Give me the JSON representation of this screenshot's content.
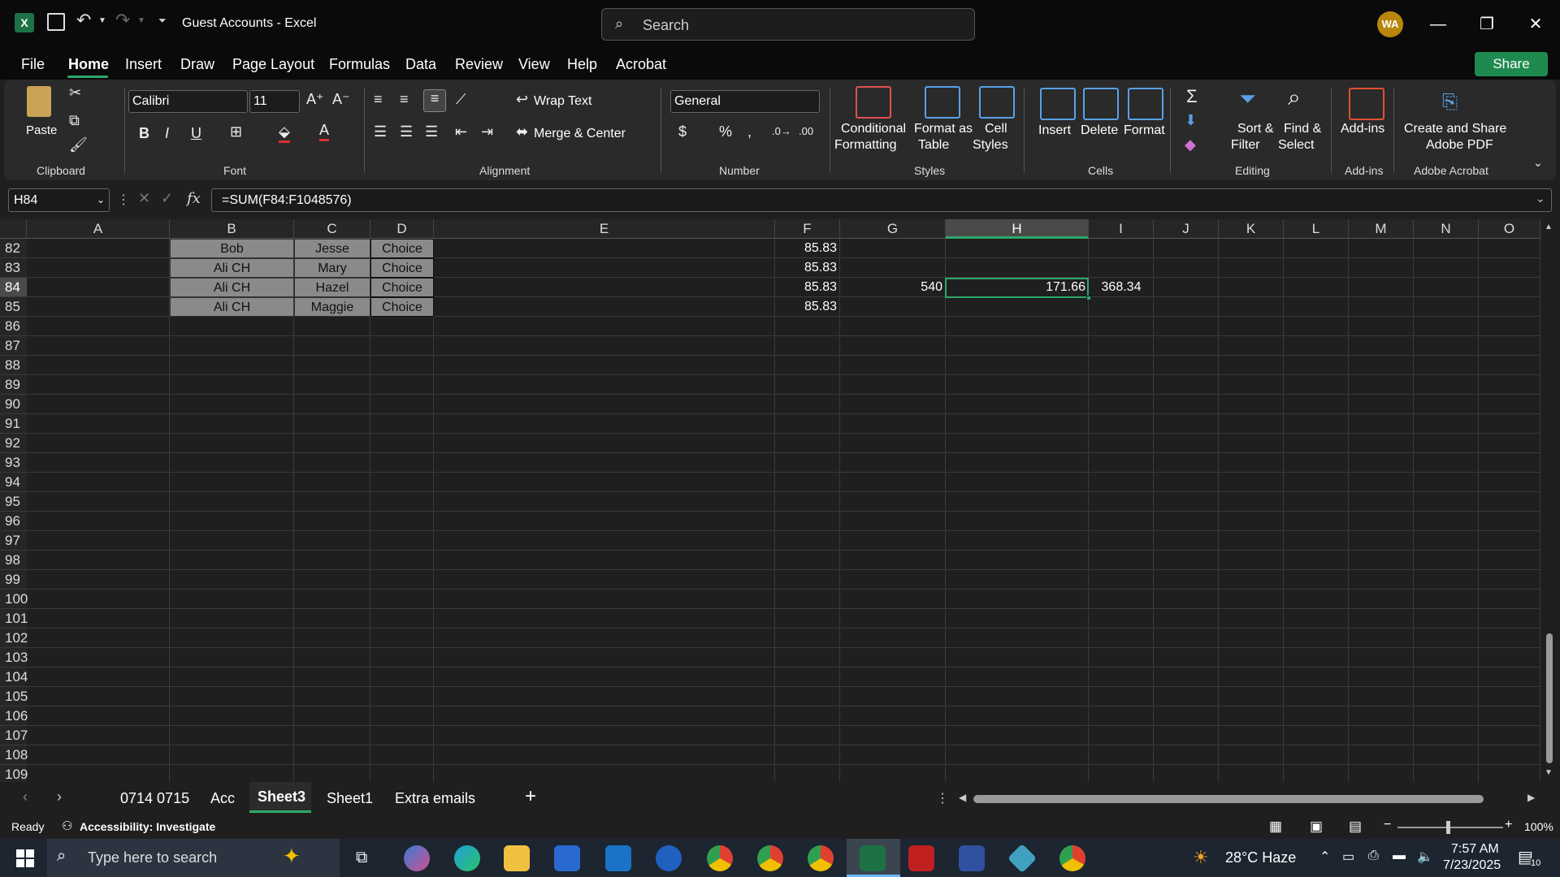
{
  "window": {
    "title": "Guest Accounts  -  Excel",
    "search_placeholder": "Search",
    "user_initials": "WA",
    "minimize": "—",
    "restore": "❐",
    "close": "✕"
  },
  "menu": {
    "tabs": [
      "File",
      "Home",
      "Insert",
      "Draw",
      "Page Layout",
      "Formulas",
      "Data",
      "Review",
      "View",
      "Help",
      "Acrobat"
    ],
    "active": "Home",
    "share": "Share"
  },
  "ribbon": {
    "clipboard": {
      "paste": "Paste",
      "label": "Clipboard"
    },
    "font": {
      "name": "Calibri",
      "size": "11",
      "label": "Font"
    },
    "alignment": {
      "wrap": "Wrap Text",
      "merge": "Merge & Center",
      "label": "Alignment"
    },
    "number": {
      "format": "General",
      "label": "Number",
      "currency": "$",
      "percent": "%"
    },
    "styles": {
      "conditional_1": "Conditional",
      "conditional_2": "Formatting",
      "format_table_1": "Format as",
      "format_table_2": "Table",
      "cell_styles_1": "Cell",
      "cell_styles_2": "Styles",
      "label": "Styles"
    },
    "cells": {
      "insert": "Insert",
      "delete": "Delete",
      "format": "Format",
      "label": "Cells"
    },
    "editing": {
      "sort_1": "Sort &",
      "sort_2": "Filter",
      "find_1": "Find &",
      "find_2": "Select",
      "label": "Editing"
    },
    "addins": {
      "addins": "Add-ins",
      "label": "Add-ins"
    },
    "acrobat": {
      "line1": "Create and Share",
      "line2": "Adobe PDF",
      "label": "Adobe Acrobat"
    }
  },
  "formula_bar": {
    "name_box": "H84",
    "fx": "fx",
    "formula": "=SUM(F84:F1048576)"
  },
  "grid": {
    "columns": [
      "A",
      "B",
      "C",
      "D",
      "E",
      "F",
      "G",
      "H",
      "I",
      "J",
      "K",
      "L",
      "M",
      "N",
      "O"
    ],
    "selected_column": "H",
    "rows": [
      "82",
      "83",
      "84",
      "85",
      "86",
      "87",
      "88",
      "89",
      "90",
      "91",
      "92",
      "93",
      "94",
      "95",
      "96",
      "97",
      "98",
      "99",
      "100",
      "101",
      "102",
      "103",
      "104",
      "105",
      "106",
      "107",
      "108",
      "109"
    ],
    "selected_row": "84",
    "data": [
      {
        "B": "Bob",
        "C": "Jesse",
        "D": "Choice",
        "F": "85.83"
      },
      {
        "B": "Ali CH",
        "C": "Mary",
        "D": "Choice",
        "F": "85.83"
      },
      {
        "B": "Ali CH",
        "C": "Hazel",
        "D": "Choice",
        "F": "85.83",
        "G": "540",
        "H": "171.66",
        "I": "368.34"
      },
      {
        "B": "Ali CH",
        "C": "Maggie",
        "D": "Choice",
        "F": "85.83"
      }
    ]
  },
  "sheets": {
    "tabs": [
      "0714 0715",
      "Acc",
      "Sheet3",
      "Sheet1",
      "Extra emails"
    ],
    "active": "Sheet3",
    "add": "+"
  },
  "status": {
    "ready": "Ready",
    "accessibility": "Accessibility: Investigate",
    "zoom": "100%"
  },
  "taskbar": {
    "search_placeholder": "Type here to search",
    "weather": "28°C  Haze",
    "time": "7:57 AM",
    "date": "7/23/2025",
    "notifications": "10"
  }
}
